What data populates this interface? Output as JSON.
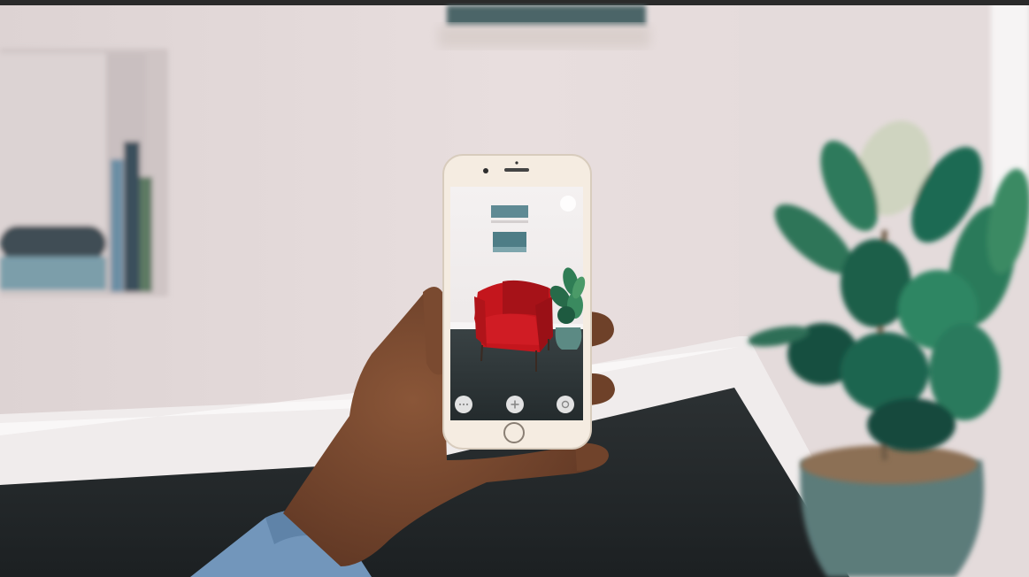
{
  "scene": {
    "description_colors": {
      "wall": "#e6dcdc",
      "floor": "#23282a",
      "baseboard": "#f1eeee",
      "chair": "#c0161c",
      "phone_body": "#f4ebe0",
      "plant_green": "#2f7a5c",
      "sleeve": "#6f93b9",
      "skin": "#6b3f29"
    }
  },
  "phone_app": {
    "buttons": [
      {
        "name": "options-button",
        "icon": "ellipsis-icon"
      },
      {
        "name": "add-button",
        "icon": "plus-icon"
      },
      {
        "name": "capture-button",
        "icon": "aperture-icon"
      }
    ]
  }
}
